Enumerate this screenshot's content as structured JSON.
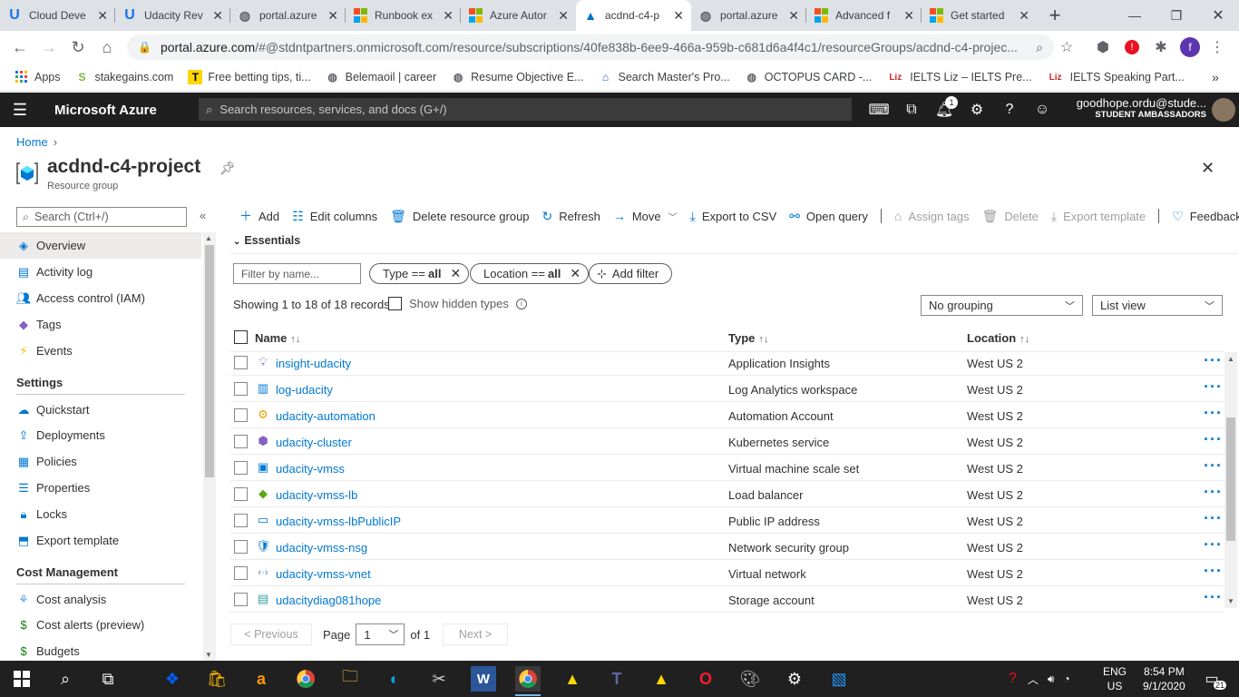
{
  "browser": {
    "tabs": [
      {
        "title": "Cloud Deve",
        "icon": "udacity-icon",
        "active": false
      },
      {
        "title": "Udacity Rev",
        "icon": "udacity-icon",
        "active": false
      },
      {
        "title": "portal.azure",
        "icon": "globe-icon",
        "active": false
      },
      {
        "title": "Runbook ex",
        "icon": "microsoft-icon",
        "active": false
      },
      {
        "title": "Azure Autor",
        "icon": "microsoft-icon",
        "active": false
      },
      {
        "title": "acdnd-c4-p",
        "icon": "azure-icon",
        "active": true
      },
      {
        "title": "portal.azure",
        "icon": "globe-icon",
        "active": false
      },
      {
        "title": "Advanced f",
        "icon": "microsoft-icon",
        "active": false
      },
      {
        "title": "Get started",
        "icon": "microsoft-icon",
        "active": false
      }
    ],
    "url_host": "portal.azure.com",
    "url_path": "/#@stdntpartners.onmicrosoft.com/resource/subscriptions/40fe838b-6ee9-466a-959b-c681d6a4f4c1/resourceGroups/acdnd-c4-projec...",
    "bookmarks": [
      {
        "label": "Apps",
        "icon": "apps-grid-icon"
      },
      {
        "label": "stakegains.com",
        "icon": "stakegains-icon"
      },
      {
        "label": "Free betting tips, ti...",
        "icon": "tips-icon"
      },
      {
        "label": "Belemaoil | career",
        "icon": "globe-icon"
      },
      {
        "label": "Resume Objective E...",
        "icon": "globe-icon"
      },
      {
        "label": "Search Master's Pro...",
        "icon": "building-icon"
      },
      {
        "label": "OCTOPUS CARD -...",
        "icon": "globe-icon"
      },
      {
        "label": "IELTS Liz – IELTS Pre...",
        "icon": "liz-icon"
      },
      {
        "label": "IELTS Speaking Part...",
        "icon": "liz-icon"
      }
    ],
    "profile_initial": "f"
  },
  "azure_header": {
    "brand": "Microsoft Azure",
    "search_placeholder": "Search resources, services, and docs (G+/)",
    "notification_count": "1",
    "user_name": "goodhope.ordu@stude...",
    "user_directory": "STUDENT AMBASSADORS"
  },
  "breadcrumb": {
    "home": "Home"
  },
  "page": {
    "title": "acdnd-c4-project",
    "subtitle": "Resource group"
  },
  "sidebar": {
    "search_placeholder": "Search (Ctrl+/)",
    "items": [
      {
        "label": "Overview",
        "icon": "overview-icon",
        "selected": true
      },
      {
        "label": "Activity log",
        "icon": "activity-log-icon"
      },
      {
        "label": "Access control (IAM)",
        "icon": "iam-icon"
      },
      {
        "label": "Tags",
        "icon": "tag-icon"
      },
      {
        "label": "Events",
        "icon": "lightning-icon"
      }
    ],
    "settings_heading": "Settings",
    "settings_items": [
      {
        "label": "Quickstart",
        "icon": "quickstart-icon"
      },
      {
        "label": "Deployments",
        "icon": "deployments-icon"
      },
      {
        "label": "Policies",
        "icon": "policies-icon"
      },
      {
        "label": "Properties",
        "icon": "properties-icon"
      },
      {
        "label": "Locks",
        "icon": "lock-icon"
      },
      {
        "label": "Export template",
        "icon": "export-template-icon"
      }
    ],
    "cost_heading": "Cost Management",
    "cost_items": [
      {
        "label": "Cost analysis",
        "icon": "cost-analysis-icon"
      },
      {
        "label": "Cost alerts (preview)",
        "icon": "cost-alert-icon"
      },
      {
        "label": "Budgets",
        "icon": "budget-icon"
      }
    ]
  },
  "toolbar": {
    "add": "Add",
    "edit_columns": "Edit columns",
    "delete_group": "Delete resource group",
    "refresh": "Refresh",
    "move": "Move",
    "export_csv": "Export to CSV",
    "open_query": "Open query",
    "assign_tags": "Assign tags",
    "delete": "Delete",
    "export_template": "Export template",
    "feedback": "Feedback"
  },
  "essentials": {
    "label": "Essentials"
  },
  "filters": {
    "name_placeholder": "Filter by name...",
    "type_prefix": "Type == ",
    "type_value": "all",
    "location_prefix": "Location == ",
    "location_value": "all",
    "add_filter": "Add filter"
  },
  "records": {
    "summary": "Showing 1 to 18 of 18 records.",
    "show_hidden": "Show hidden types",
    "grouping": "No grouping",
    "view": "List view"
  },
  "table": {
    "columns": {
      "name": "Name",
      "type": "Type",
      "location": "Location"
    },
    "rows": [
      {
        "name": "insight-udacity",
        "type": "Application Insights",
        "location": "West US 2",
        "icon": "app-insights-icon"
      },
      {
        "name": "log-udacity",
        "type": "Log Analytics workspace",
        "location": "West US 2",
        "icon": "log-analytics-icon"
      },
      {
        "name": "udacity-automation",
        "type": "Automation Account",
        "location": "West US 2",
        "icon": "automation-icon"
      },
      {
        "name": "udacity-cluster",
        "type": "Kubernetes service",
        "location": "West US 2",
        "icon": "kubernetes-icon"
      },
      {
        "name": "udacity-vmss",
        "type": "Virtual machine scale set",
        "location": "West US 2",
        "icon": "vmss-icon"
      },
      {
        "name": "udacity-vmss-lb",
        "type": "Load balancer",
        "location": "West US 2",
        "icon": "load-balancer-icon"
      },
      {
        "name": "udacity-vmss-lbPublicIP",
        "type": "Public IP address",
        "location": "West US 2",
        "icon": "public-ip-icon"
      },
      {
        "name": "udacity-vmss-nsg",
        "type": "Network security group",
        "location": "West US 2",
        "icon": "nsg-icon"
      },
      {
        "name": "udacity-vmss-vnet",
        "type": "Virtual network",
        "location": "West US 2",
        "icon": "vnet-icon"
      },
      {
        "name": "udacitydiag081hope",
        "type": "Storage account",
        "location": "West US 2",
        "icon": "storage-icon"
      }
    ]
  },
  "pager": {
    "previous": "< Previous",
    "page_label": "Page",
    "page_value": "1",
    "of_label": "of 1",
    "next": "Next >"
  },
  "taskbar": {
    "language": "ENG",
    "region": "US",
    "time": "8:54 PM",
    "date": "9/1/2020",
    "notification_count": "21"
  },
  "colors": {
    "azure_header_bg": "#1f1f1f",
    "link_blue": "#0078d4",
    "taskbar_bg": "#202020"
  }
}
